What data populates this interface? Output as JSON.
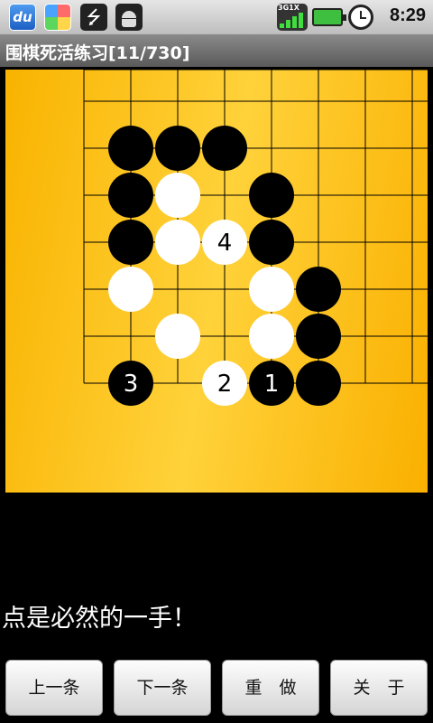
{
  "status_bar": {
    "du_label": "du",
    "signal_label": "3G1X",
    "time": "8:29",
    "icons": [
      "du-browser-icon",
      "pinwheel-app-icon",
      "usb-icon",
      "android-debug-icon",
      "signal-icon",
      "battery-icon",
      "alarm-clock-icon"
    ]
  },
  "title": "围棋死活练习[11/730]",
  "board": {
    "grid_lines": 9,
    "stones": [
      {
        "color": "black",
        "col": 1,
        "row": 1
      },
      {
        "color": "black",
        "col": 2,
        "row": 1
      },
      {
        "color": "black",
        "col": 3,
        "row": 1
      },
      {
        "color": "black",
        "col": 1,
        "row": 2
      },
      {
        "color": "white",
        "col": 2,
        "row": 2
      },
      {
        "color": "black",
        "col": 4,
        "row": 2
      },
      {
        "color": "black",
        "col": 1,
        "row": 3
      },
      {
        "color": "white",
        "col": 2,
        "row": 3
      },
      {
        "color": "white",
        "col": 3,
        "row": 3,
        "label": "4"
      },
      {
        "color": "black",
        "col": 4,
        "row": 3
      },
      {
        "color": "white",
        "col": 1,
        "row": 4
      },
      {
        "color": "white",
        "col": 4,
        "row": 4
      },
      {
        "color": "black",
        "col": 5,
        "row": 4
      },
      {
        "color": "white",
        "col": 2,
        "row": 5
      },
      {
        "color": "white",
        "col": 4,
        "row": 5
      },
      {
        "color": "black",
        "col": 5,
        "row": 5
      },
      {
        "color": "black",
        "col": 1,
        "row": 6,
        "label": "3"
      },
      {
        "color": "white",
        "col": 3,
        "row": 6,
        "label": "2"
      },
      {
        "color": "black",
        "col": 4,
        "row": 6,
        "label": "1"
      },
      {
        "color": "black",
        "col": 5,
        "row": 6
      }
    ]
  },
  "message": "点是必然的一手！",
  "buttons": {
    "prev": "上一条",
    "next": "下一条",
    "redo": "重　做",
    "about": "关　于"
  },
  "colors": {
    "board": "#fbc21a",
    "black_stone": "#000000",
    "white_stone": "#ffffff",
    "grid": "#000000"
  }
}
